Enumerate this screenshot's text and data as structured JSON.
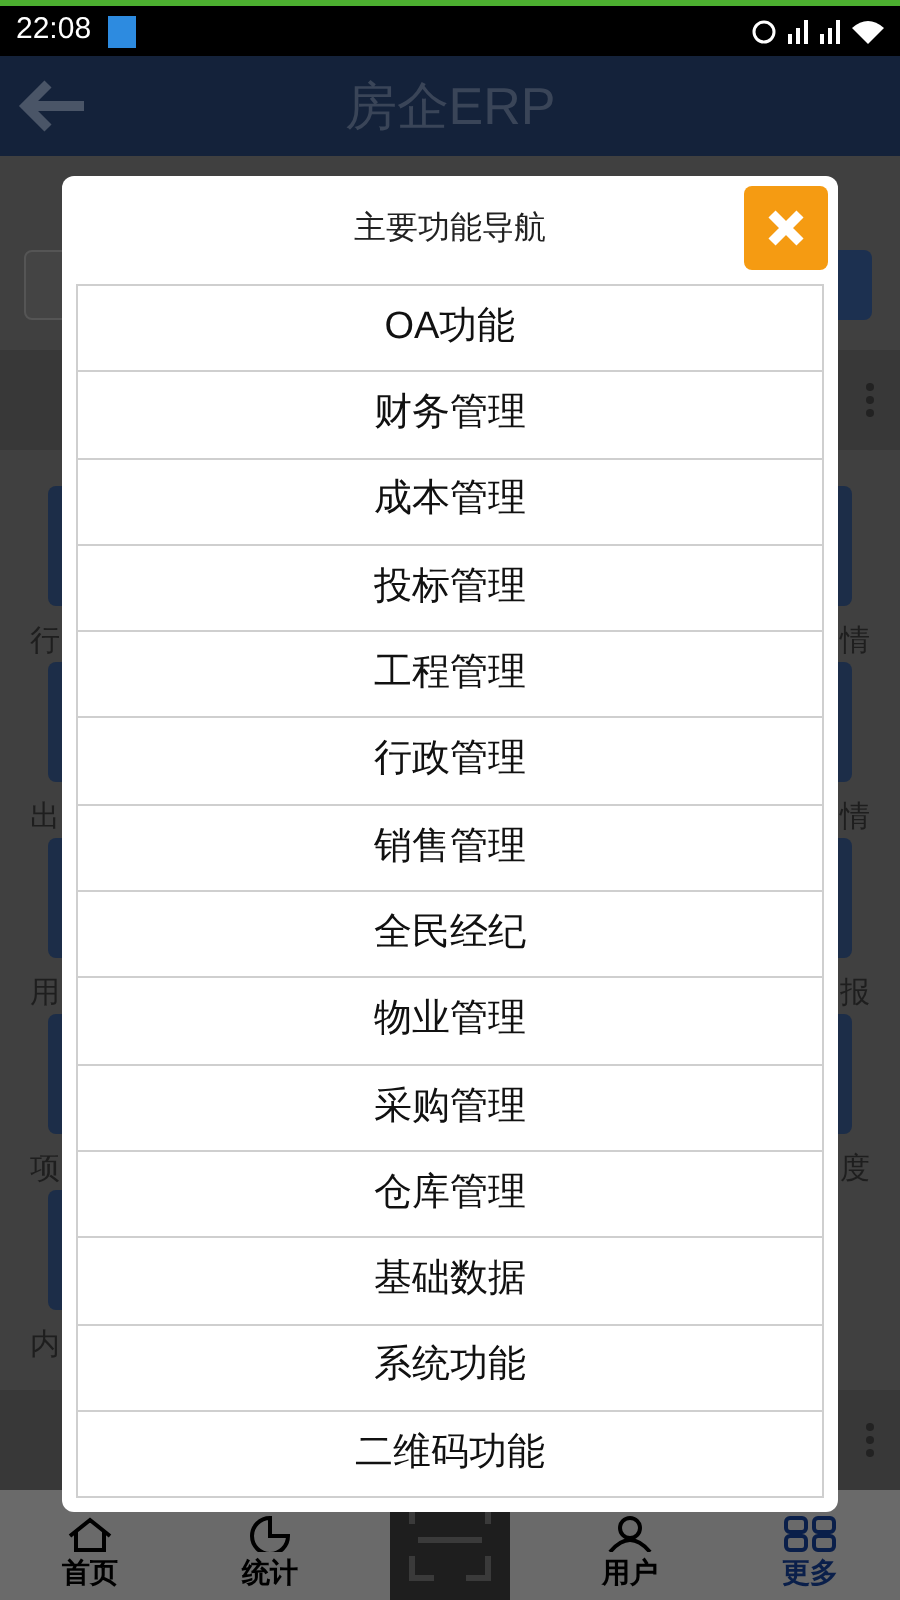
{
  "status_bar": {
    "time": "22:08"
  },
  "header": {
    "title": "房企ERP"
  },
  "background": {
    "left_labels": [
      "行",
      "出",
      "用",
      "项",
      "内"
    ],
    "right_labels": [
      "情",
      "情",
      "报",
      "度"
    ]
  },
  "dialog": {
    "title": "主要功能导航",
    "items": [
      "OA功能",
      "财务管理",
      "成本管理",
      "投标管理",
      "工程管理",
      "行政管理",
      "销售管理",
      "全民经纪",
      "物业管理",
      "采购管理",
      "仓库管理",
      "基础数据",
      "系统功能",
      "二维码功能"
    ]
  },
  "bottom_nav": [
    {
      "kind": "home",
      "label": "首页",
      "selected": false
    },
    {
      "kind": "stats",
      "label": "统计",
      "selected": false
    },
    {
      "kind": "scan",
      "selected": false
    },
    {
      "kind": "user",
      "label": "用户",
      "selected": false
    },
    {
      "kind": "more",
      "label": "更多",
      "selected": true
    }
  ]
}
